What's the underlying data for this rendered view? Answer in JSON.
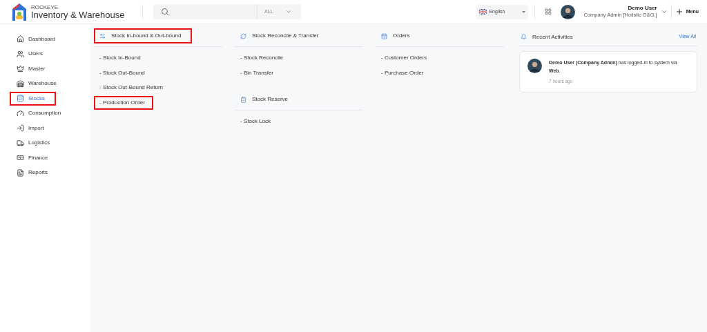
{
  "header": {
    "brand_top": "ROCKEYE",
    "brand": "Inventory & Warehouse",
    "search": {
      "filter": "ALL"
    },
    "language": "English",
    "user": {
      "name": "Demo User",
      "role": "Company Admin [Holistic O&G.]"
    },
    "menu": "Menu"
  },
  "sidebar": {
    "items": [
      {
        "label": "Dashboard",
        "selected": false,
        "highlighted": false
      },
      {
        "label": "Users",
        "selected": false,
        "highlighted": false
      },
      {
        "label": "Master",
        "selected": false,
        "highlighted": false
      },
      {
        "label": "Warehouse",
        "selected": false,
        "highlighted": false
      },
      {
        "label": "Stocks",
        "selected": true,
        "highlighted": true
      },
      {
        "label": "Consumption",
        "selected": false,
        "highlighted": false
      },
      {
        "label": "Import",
        "selected": false,
        "highlighted": false
      },
      {
        "label": "Logistics",
        "selected": false,
        "highlighted": false
      },
      {
        "label": "Finance",
        "selected": false,
        "highlighted": false
      },
      {
        "label": "Reports",
        "selected": false,
        "highlighted": false
      }
    ]
  },
  "columns": [
    {
      "sections": [
        {
          "title": "Stock In-bound & Out-bound",
          "highlighted": true,
          "items": [
            {
              "label": "- Stock In-Bound",
              "highlighted": false
            },
            {
              "label": "- Stock Out-Bound",
              "highlighted": false
            },
            {
              "label": "- Stock Out-Bound Return",
              "highlighted": false
            },
            {
              "label": "- Production Order",
              "highlighted": true
            }
          ]
        }
      ]
    },
    {
      "sections": [
        {
          "title": "Stock Reconcile & Transfer",
          "highlighted": false,
          "items": [
            {
              "label": "- Stock Reconcile",
              "highlighted": false
            },
            {
              "label": "- Bin Transfer",
              "highlighted": false
            }
          ]
        },
        {
          "title": "Stock Reserve",
          "highlighted": false,
          "items": [
            {
              "label": "- Stock Lock",
              "highlighted": false
            }
          ]
        }
      ]
    },
    {
      "sections": [
        {
          "title": "Orders",
          "highlighted": false,
          "items": [
            {
              "label": "- Customer Orders",
              "highlighted": false
            },
            {
              "label": "- Purchase Order",
              "highlighted": false
            }
          ]
        }
      ]
    }
  ],
  "recent_activities": {
    "title": "Recent Activities",
    "view_all": "View All",
    "items": [
      {
        "text": "**Demo User (Company Admin)** has logged-in to system via **Web**.",
        "time": "7 hours ago"
      }
    ]
  }
}
